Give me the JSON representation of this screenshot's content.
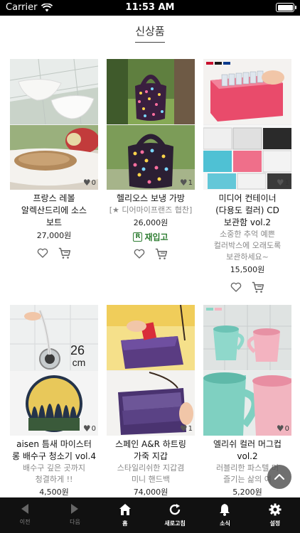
{
  "status_bar": {
    "carrier": "Carrier",
    "time": "11:53 AM"
  },
  "page": {
    "title": "신상품"
  },
  "products": [
    {
      "name_line1": "프랑스 레볼",
      "name_line2": "알렉산드리에 소스",
      "name_line3": "보트",
      "subtitle": "",
      "price": "27,000원",
      "likes": "0",
      "restock": "",
      "desc_line1": "",
      "desc_line2": "",
      "desc_line3": ""
    },
    {
      "name_line1": "헬리오스 보냉 가방",
      "name_line2": "",
      "name_line3": "",
      "subtitle": "[★ 디어마이프랜즈 협찬]",
      "price": "26,000원",
      "likes": "1",
      "restock": "재입고",
      "desc_line1": "",
      "desc_line2": "",
      "desc_line3": ""
    },
    {
      "name_line1": "미디어 컨테이너",
      "name_line2": "(다용도 컬러) CD",
      "name_line3": "보관함 vol.2",
      "subtitle": "",
      "price": "15,500원",
      "likes": "1",
      "restock": "",
      "desc_line1": "소중한 추억 예쁜",
      "desc_line2": "컬러박스에 오래도록",
      "desc_line3": "보관하세요~"
    },
    {
      "name_line1": "aisen 틈새 마이스터",
      "name_line2": "롱 배수구 청소기 vol.4",
      "name_line3": "",
      "subtitle": "",
      "price": "4,500원",
      "likes": "0",
      "restock": "",
      "desc_line1": "배수구 깊은 곳까지",
      "desc_line2": "청결하게 !!",
      "desc_line3": ""
    },
    {
      "name_line1": "스페인 A&R 하트링",
      "name_line2": "가죽 지갑",
      "name_line3": "",
      "subtitle": "",
      "price": "74,000원",
      "likes": "1",
      "restock": "",
      "desc_line1": "스타일리쉬한 지갑겸",
      "desc_line2": "미니 핸드백",
      "desc_line3": ""
    },
    {
      "name_line1": "엘리쉬 컬러 머그컵",
      "name_line2": "vol.2",
      "name_line3": "",
      "subtitle": "",
      "price": "5,200원",
      "likes": "0",
      "restock": "",
      "desc_line1": "러블리한 파스텔 머",
      "desc_line2": "즐기는 삶의 여",
      "desc_line3": ""
    }
  ],
  "image_text": {
    "drain_size": "26",
    "drain_unit": "cm"
  },
  "tabs": [
    {
      "label": "이전",
      "icon": "back-arrow-icon"
    },
    {
      "label": "다음",
      "icon": "forward-arrow-icon"
    },
    {
      "label": "홈",
      "icon": "home-icon"
    },
    {
      "label": "새로고침",
      "icon": "refresh-icon"
    },
    {
      "label": "소식",
      "icon": "bell-icon"
    },
    {
      "label": "설정",
      "icon": "gear-icon"
    }
  ],
  "colors": {
    "restock_green": "#2e7d32",
    "tabbar_bg": "#111111"
  }
}
